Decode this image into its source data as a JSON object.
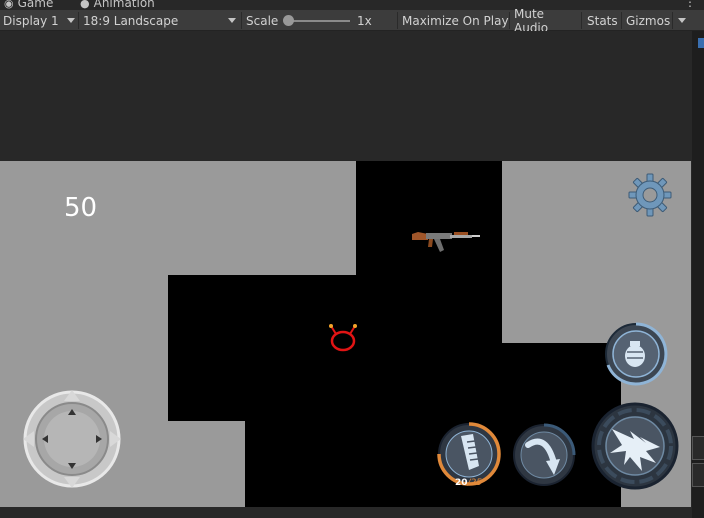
{
  "tabs": [
    {
      "label": "Game",
      "icon": "gamepad-icon"
    },
    {
      "label": "Animation",
      "icon": "animation-icon"
    }
  ],
  "toolbar": {
    "display": "Display 1",
    "aspect": "18:9 Landscape",
    "scale_label": "Scale",
    "scale_value": "1x",
    "maximize": "Maximize On Play",
    "mute": "Mute Audio",
    "stats": "Stats",
    "gizmos": "Gizmos"
  },
  "game": {
    "score": "50",
    "ammo_current": "20",
    "ammo_max": "/25"
  },
  "colors": {
    "toolbar_bg": "#3c3c3c",
    "editor_bg": "#282828",
    "level_gray": "#9a9a9a",
    "ammo_orange": "#e0893a",
    "button_blue": "#8fb4d6",
    "player_red": "#e11414"
  }
}
